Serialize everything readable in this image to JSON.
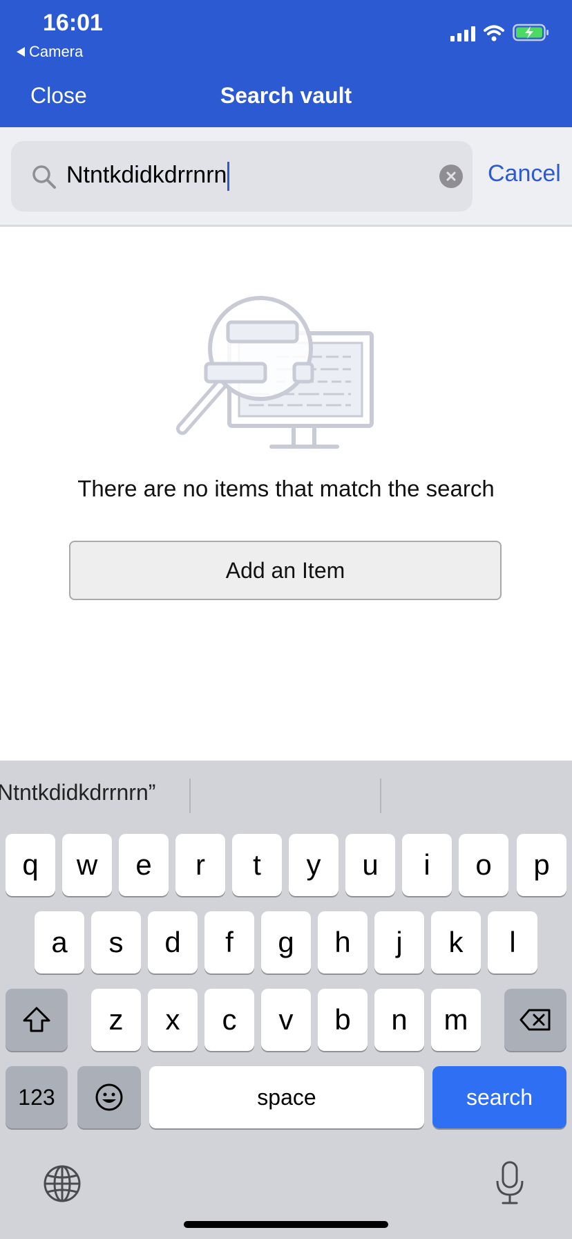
{
  "status_bar": {
    "time": "16:01",
    "back_app": "Camera"
  },
  "nav": {
    "close_label": "Close",
    "title": "Search vault"
  },
  "search": {
    "query": "Ntntkdidkdrrnrn",
    "cancel_label": "Cancel"
  },
  "empty_state": {
    "message": "There are no items that match the search",
    "add_label": "Add an Item"
  },
  "keyboard": {
    "suggestions": [
      "Ntntkdidkdrrnrn”",
      "",
      ""
    ],
    "row1": [
      "q",
      "w",
      "e",
      "r",
      "t",
      "y",
      "u",
      "i",
      "o",
      "p"
    ],
    "row2": [
      "a",
      "s",
      "d",
      "f",
      "g",
      "h",
      "j",
      "k",
      "l"
    ],
    "row3": [
      "z",
      "x",
      "c",
      "v",
      "b",
      "n",
      "m"
    ],
    "numbers_label": "123",
    "space_label": "space",
    "search_label": "search"
  },
  "colors": {
    "header_bg": "#2c5ad3",
    "accent": "#2c5ad3",
    "search_key": "#2f6ff3"
  },
  "icons": [
    "signal-icon",
    "wifi-icon",
    "battery-icon",
    "search-icon",
    "clear-icon",
    "shift-icon",
    "delete-icon",
    "emoji-icon",
    "globe-icon",
    "microphone-icon"
  ]
}
